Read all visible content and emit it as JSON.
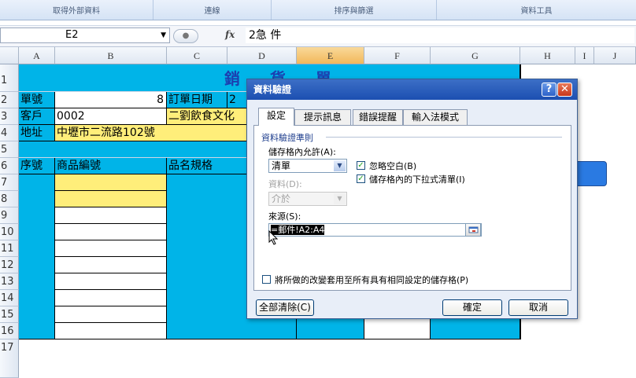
{
  "ribbon": {
    "groups": [
      "取得外部資料",
      "連線",
      "排序與篩選",
      "資料工具"
    ]
  },
  "formula_bar": {
    "name_box": "E2",
    "fx_label": "fx",
    "formula": "2急  件"
  },
  "columns": [
    "A",
    "B",
    "C",
    "D",
    "E",
    "F",
    "G",
    "H",
    "I",
    "J"
  ],
  "selected_column": "E",
  "rows": [
    "1",
    "2",
    "3",
    "4",
    "5",
    "6",
    "7",
    "8",
    "9",
    "10",
    "11",
    "12",
    "13",
    "14",
    "15",
    "16",
    "17"
  ],
  "sheet": {
    "title": "銷  貨  單",
    "a2": "單號",
    "b2": "8",
    "c2": "訂單日期",
    "d2": "2",
    "a3": "客戶",
    "b3": "0002",
    "c3": "二劉飲食文化",
    "a4": "地址",
    "b4": "中壢市二流路102號",
    "a6": "序號",
    "b6": "商品編號",
    "c6": "品名規格"
  },
  "dialog": {
    "title": "資料驗證",
    "help_icon": "question-icon",
    "close_icon": "close-icon",
    "tabs": [
      "設定",
      "提示訊息",
      "錯誤提醒",
      "輸入法模式"
    ],
    "active_tab": "設定",
    "section": "資料驗證準則",
    "allow_label": "儲存格內允許(A):",
    "allow_value": "清單",
    "ignore_blank_label": "忽略空白(B)",
    "ignore_blank_checked": true,
    "dropdown_label": "儲存格內的下拉式清單(I)",
    "dropdown_checked": true,
    "data_label": "資料(D):",
    "data_value": "介於",
    "source_label": "來源(S):",
    "source_value": "=郵件!A2:A4",
    "apply_all_label": "將所做的改變套用至所有具有相同設定的儲存格(P)",
    "apply_all_checked": false,
    "clear_all": "全部清除(C)",
    "ok": "確定",
    "cancel": "取消"
  }
}
